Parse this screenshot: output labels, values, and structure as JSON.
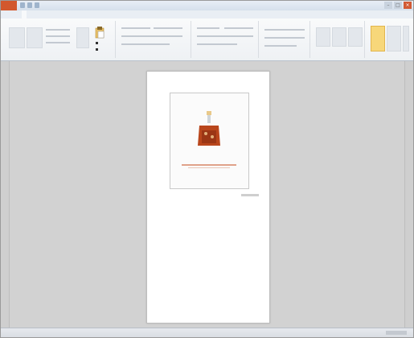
{
  "window": {
    "title": ""
  },
  "ribbon_tabs": [
    {
      "label": ""
    },
    {
      "label": ""
    },
    {
      "label": ""
    },
    {
      "label": ""
    },
    {
      "label": ""
    },
    {
      "label": ""
    },
    {
      "label": ""
    },
    {
      "label": ""
    }
  ],
  "colors": {
    "accent_orange": "#d2582d",
    "highlight": "#f7d77a",
    "page": "#ffffff",
    "workspace": "#d2d2d2"
  },
  "icons": {
    "office_button": "office-logo-icon",
    "paste": "paste-icon",
    "close": "close-icon"
  },
  "document": {
    "image_description_hidden": true
  }
}
